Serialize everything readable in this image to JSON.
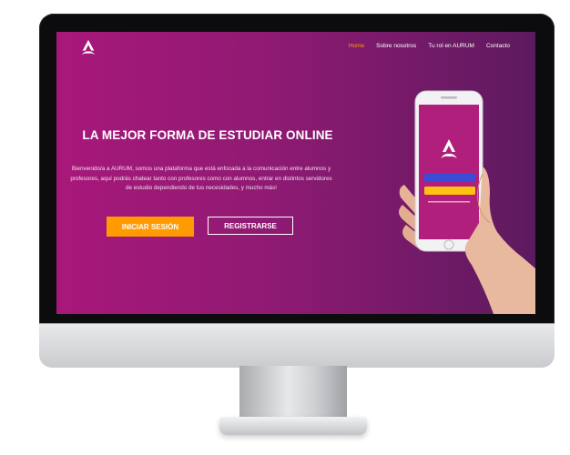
{
  "nav": {
    "items": [
      {
        "label": "Home",
        "active": true
      },
      {
        "label": "Sobre nosotros",
        "active": false
      },
      {
        "label": "Tu rol en AURUM",
        "active": false
      },
      {
        "label": "Contacto",
        "active": false
      }
    ]
  },
  "hero": {
    "title": "LA MEJOR FORMA DE ESTUDIAR ONLINE",
    "intro": "Bienvenido/a a AURUM, somos una plataforma que está enfocada a la comunicación entre alumnos y profesores, aquí podrás chatear tanto con profesores como con alumnos, entrar en distintos servidores de estudio dependiendo de tus necesidades, y mucho más!",
    "login_label": "INICIAR SESIÓN",
    "register_label": "REGISTRARSE"
  },
  "colors": {
    "accent": "#ff9a00",
    "gradient_start": "#a8187a",
    "gradient_end": "#5d1a5e"
  },
  "icons": {
    "logo": "aurum-logo-icon"
  }
}
